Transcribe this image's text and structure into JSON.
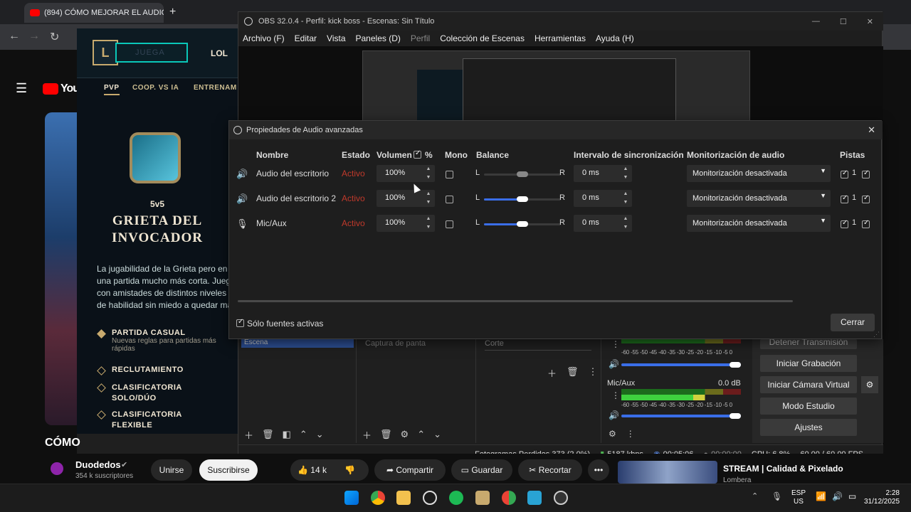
{
  "browser": {
    "tab_title": "(894) CÓMO MEJORAR EL AUDIO",
    "new_tab": "+",
    "close_tab": "✕"
  },
  "youtube": {
    "logo": "You",
    "channel_name": "Duodedos",
    "subscribers": "354 k suscriptores",
    "join_label": "Unirse",
    "subscribe_label": "Suscribirse",
    "likes": "14 k",
    "share_label": "Compartir",
    "save_label": "Guardar",
    "clip_label": "Recortar",
    "more_label": "•••",
    "side_title": "CÓMO",
    "reco_title": "STREAM | Calidad & Pixelado",
    "reco_channel": "Lombera"
  },
  "lol": {
    "play_label": "JUEGA",
    "nav_lol": "LOL",
    "sub_pvp": "PVP",
    "sub_coop": "COOP. VS IA",
    "sub_training": "ENTRENAM",
    "mode_size": "5v5",
    "mode_name_1": "GRIETA DEL",
    "mode_name_2": "INVOCADOR",
    "desc": "La jugabilidad de la Grieta pero en una partida mucho más corta. Juega con amistades de distintos niveles de habilidad sin miedo a quedar ma",
    "options": [
      {
        "title": "PARTIDA CASUAL",
        "sub": "Nuevas reglas para partidas más rápidas"
      },
      {
        "title": "RECLUTAMIENTO",
        "sub": ""
      },
      {
        "title": "CLASIFICATORIA SOLO/DÚO",
        "sub": ""
      },
      {
        "title": "CLASIFICATORIA FLEXIBLE",
        "sub": ""
      }
    ]
  },
  "obs": {
    "title": "OBS 32.0.4 - Perfil: kick boss - Escenas: Sin Título",
    "menu": [
      "Archivo (F)",
      "Editar",
      "Vista",
      "Paneles (D)",
      "Perfil",
      "Colección de Escenas",
      "Herramientas",
      "Ayuda (H)"
    ],
    "scene_item": "Escena",
    "source_item": "Captura de panta",
    "transition": "Corte",
    "mic_label": "Mic/Aux",
    "mic_db": "0.0 dB",
    "meter_scale": "-60 -55 -50 -45 -40 -35 -30 -25 -20 -15 -10 -5 0",
    "controls": {
      "stop_stream": "Detener Transmisión",
      "start_record": "Iniciar Grabación",
      "virtual_cam": "Iniciar Cámara Virtual",
      "studio": "Modo Estudio",
      "settings": "Ajustes"
    },
    "status": {
      "dropped": "Fotogramas Perdidos 373 (2.0%)",
      "bitrate": "5187 kbps",
      "stream_time": "00:05:06",
      "rec_time": "00:00:00",
      "cpu": "CPU: 6.8%",
      "fps": "60.00 / 60.00 FPS"
    }
  },
  "dialog": {
    "title": "Propiedades de Audio avanzadas",
    "headers": {
      "name": "Nombre",
      "status": "Estado",
      "volume": "Volumen",
      "percent": "%",
      "mono": "Mono",
      "balance": "Balance",
      "sync": "Intervalo de sincronización",
      "monitor": "Monitorización de audio",
      "tracks": "Pistas"
    },
    "rows": [
      {
        "name": "Audio del escritorio",
        "status": "Activo",
        "volume": "100%",
        "sync": "0 ms",
        "monitor": "Monitorización desactivada",
        "track": "1",
        "balance": 0.5,
        "icon": "speaker-icon"
      },
      {
        "name": "Audio del escritorio 2",
        "status": "Activo",
        "volume": "100%",
        "sync": "0 ms",
        "monitor": "Monitorización desactivada",
        "track": "1",
        "balance": 0.5,
        "icon": "speaker-icon"
      },
      {
        "name": "Mic/Aux",
        "status": "Activo",
        "volume": "100%",
        "sync": "0 ms",
        "monitor": "Monitorización desactivada",
        "track": "1",
        "balance": 0.5,
        "icon": "microphone-icon"
      }
    ],
    "bal_l": "L",
    "bal_r": "R",
    "active_only": "Sólo fuentes activas",
    "close_label": "Cerrar"
  },
  "taskbar": {
    "lang": "ESP",
    "region": "US",
    "time": "2:28",
    "date": "31/12/2025"
  },
  "colors": {
    "accent_blue": "#3a6ee8",
    "status_red": "#c0392b",
    "lol_gold": "#c8aa6e",
    "lol_teal": "#0ac8b9"
  }
}
